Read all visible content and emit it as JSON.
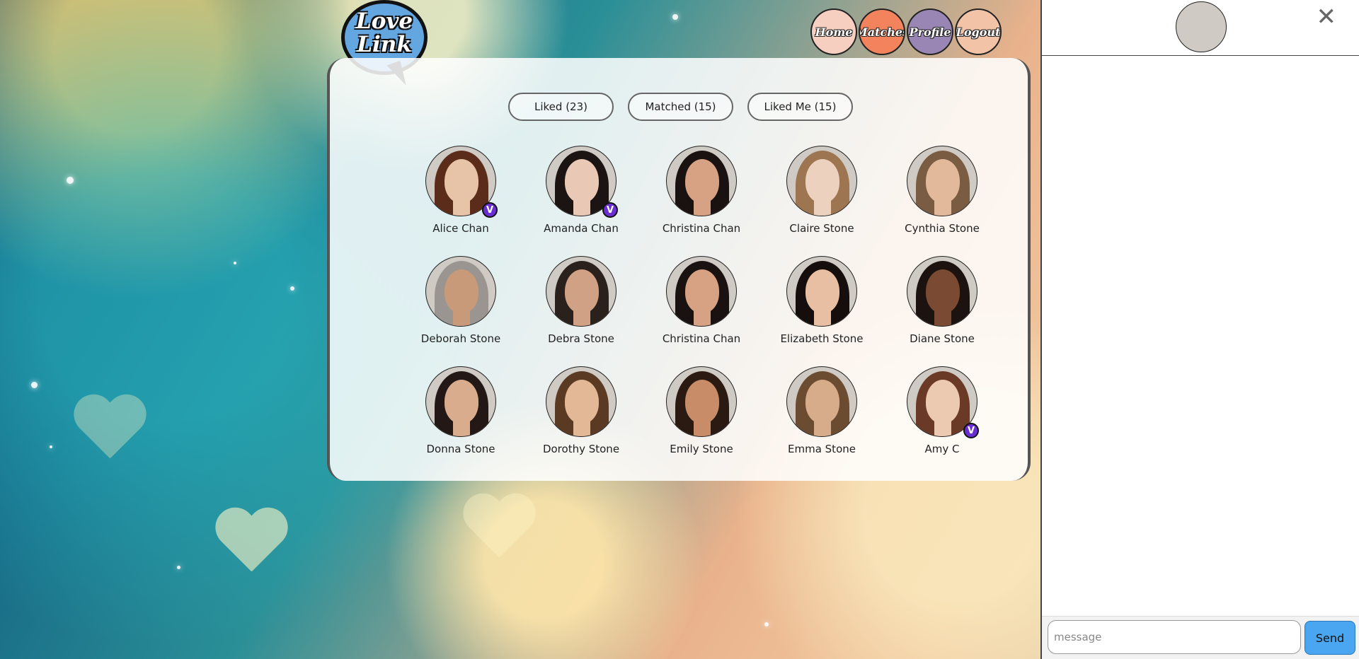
{
  "app": {
    "logo_line1": "Love",
    "logo_line2": "Link"
  },
  "nav": [
    {
      "label": "Home",
      "color": "#f6cfc1"
    },
    {
      "label": "Matches",
      "color": "#f2835c"
    },
    {
      "label": "Profile",
      "color": "#9a86b4"
    },
    {
      "label": "Logout",
      "color": "#f3c3a8"
    }
  ],
  "tabs": [
    {
      "label": "Liked (23)"
    },
    {
      "label": "Matched (15)"
    },
    {
      "label": "Liked Me (15)"
    }
  ],
  "people": [
    {
      "name": "Alice Chan",
      "verified": true,
      "skin": "#e7c3a8",
      "hair": "#5b2c1a"
    },
    {
      "name": "Amanda Chan",
      "verified": true,
      "skin": "#e9c9b6",
      "hair": "#1b1412"
    },
    {
      "name": "Christina Chan",
      "verified": false,
      "skin": "#d6a283",
      "hair": "#1a1210"
    },
    {
      "name": "Claire Stone",
      "verified": false,
      "skin": "#ecd1be",
      "hair": "#9d7550"
    },
    {
      "name": "Cynthia Stone",
      "verified": false,
      "skin": "#e3b99c",
      "hair": "#7a5c42"
    },
    {
      "name": "Deborah Stone",
      "verified": false,
      "skin": "#c99a7a",
      "hair": "#9a9590"
    },
    {
      "name": "Debra Stone",
      "verified": false,
      "skin": "#d0a184",
      "hair": "#2a201c"
    },
    {
      "name": "Christina Chan",
      "verified": false,
      "skin": "#d6a283",
      "hair": "#1a1210"
    },
    {
      "name": "Elizabeth Stone",
      "verified": false,
      "skin": "#e8bfa2",
      "hair": "#160e0c"
    },
    {
      "name": "Diane Stone",
      "verified": false,
      "skin": "#7a4a32",
      "hair": "#1c1210"
    },
    {
      "name": "Donna Stone",
      "verified": false,
      "skin": "#d9ac8e",
      "hair": "#231815"
    },
    {
      "name": "Dorothy Stone",
      "verified": false,
      "skin": "#e3b896",
      "hair": "#5a3a22"
    },
    {
      "name": "Emily Stone",
      "verified": false,
      "skin": "#c88c68",
      "hair": "#2a1a12"
    },
    {
      "name": "Emma Stone",
      "verified": false,
      "skin": "#d7ac8a",
      "hair": "#6b4c30"
    },
    {
      "name": "Amy C",
      "verified": true,
      "skin": "#eccab2",
      "hair": "#6a3a26"
    }
  ],
  "verified_badge": "V",
  "chat": {
    "avatar": {
      "skin": "#e9c9b6",
      "hair": "#1b1412"
    },
    "close_glyph": "✕",
    "placeholder": "message",
    "send_label": "Send"
  },
  "colors": {
    "verified": "#6a2fd3",
    "send": "#4aa6f0",
    "logo_blue": "#63a6e0"
  }
}
